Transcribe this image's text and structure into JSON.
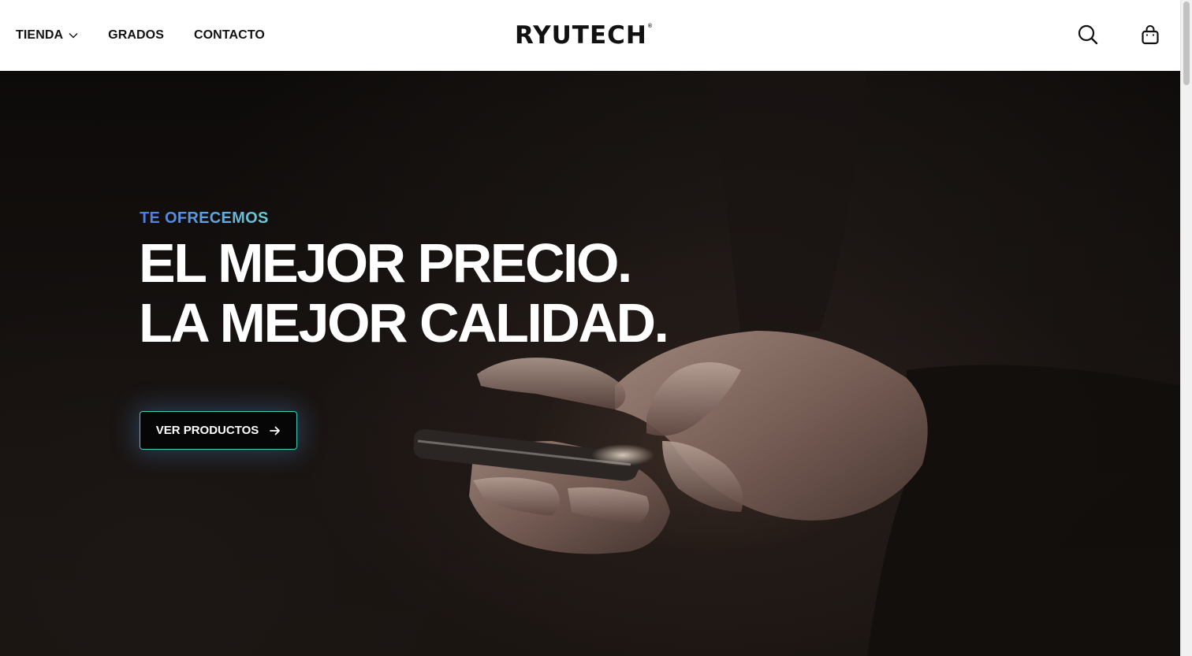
{
  "header": {
    "nav": [
      {
        "label": "TIENDA",
        "has_dropdown": true,
        "icon": "chevron-down-icon"
      },
      {
        "label": "GRADOS"
      },
      {
        "label": "CONTACTO"
      }
    ],
    "logo": {
      "text": "RYUTECH",
      "mark": "®"
    },
    "icons": {
      "search": "search-icon",
      "cart": "shopping-bag-icon"
    }
  },
  "hero": {
    "eyebrow": "TE OFRECEMOS",
    "headline_line1": "EL MEJOR PRECIO.",
    "headline_line2": "LA MEJOR CALIDAD.",
    "cta_label": "VER PRODUCTOS",
    "cta_icon": "arrow-right-icon",
    "background_image": "hands holding smartphone in the dark"
  },
  "colors": {
    "header_bg": "#ffffff",
    "text_dark": "#111111",
    "hero_text": "#ffffff",
    "eyebrow_gradient": [
      "#4e79e6",
      "#6ccfd4"
    ],
    "cta_bg": "#060606",
    "cta_border": "#3ecdb6"
  }
}
